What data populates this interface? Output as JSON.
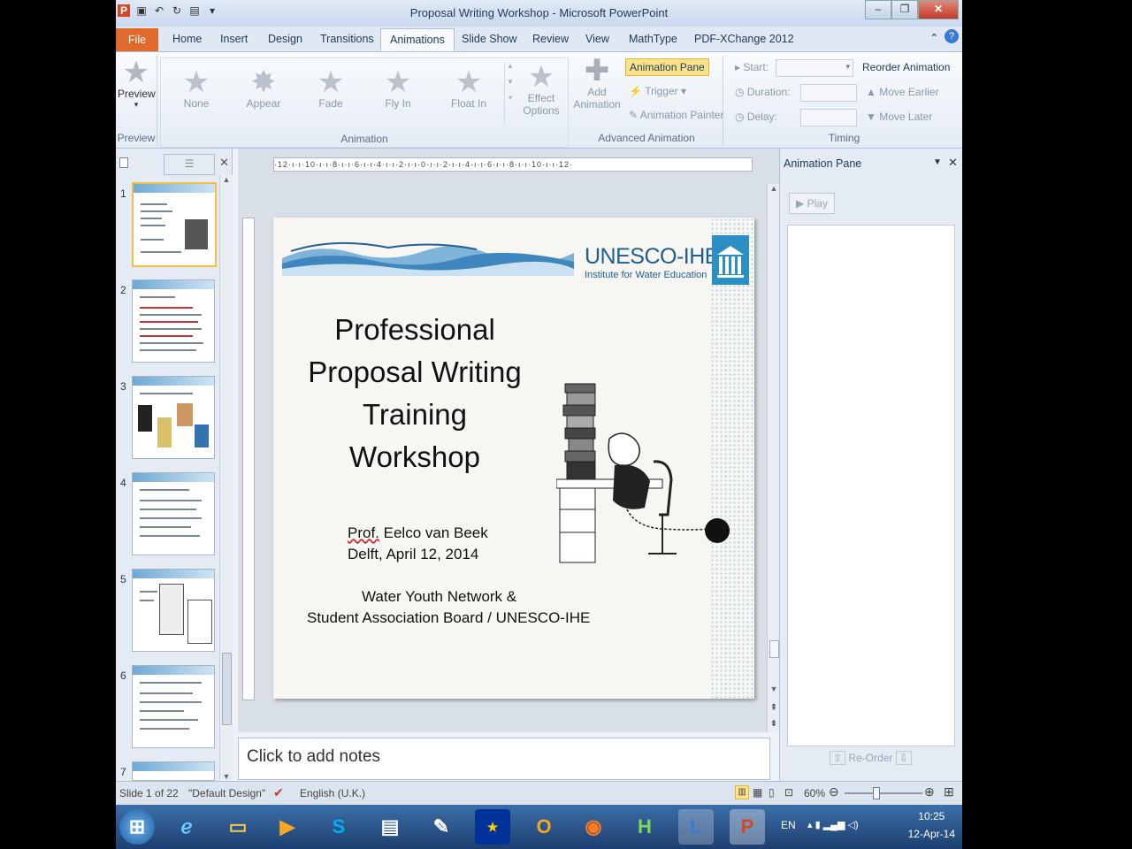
{
  "window": {
    "title": "Proposal Writing Workshop - Microsoft PowerPoint"
  },
  "tabs": [
    "File",
    "Home",
    "Insert",
    "Design",
    "Transitions",
    "Animations",
    "Slide Show",
    "Review",
    "View",
    "MathType",
    "PDF-XChange 2012"
  ],
  "active_tab": "Animations",
  "ribbon": {
    "preview": {
      "button": "Preview",
      "group": "Preview"
    },
    "animation": {
      "group": "Animation",
      "effects": [
        "None",
        "Appear",
        "Fade",
        "Fly In",
        "Float In"
      ],
      "effect_options": "Effect Options"
    },
    "advanced": {
      "group": "Advanced Animation",
      "add_animation": "Add Animation",
      "animation_pane": "Animation Pane",
      "trigger": "Trigger",
      "animation_painter": "Animation Painter"
    },
    "timing": {
      "group": "Timing",
      "start": "Start:",
      "duration": "Duration:",
      "delay": "Delay:",
      "reorder": "Reorder Animation",
      "move_earlier": "Move Earlier",
      "move_later": "Move Later"
    }
  },
  "slides_panel": {
    "numbers": [
      "1",
      "2",
      "3",
      "4",
      "5",
      "6",
      "7"
    ],
    "selected": 1
  },
  "ruler": {
    "text": "·12·ı·ı·10·ı·ı·8·ı·ı·6·ı·ı·4·ı·ı·2·ı·ı·0·ı·ı·2·ı·ı·4·ı·ı·6·ı·ı·8·ı·ı·10·ı·ı·12·"
  },
  "slide": {
    "logo": "UNESCO-IHE",
    "logo_sub": "Institute for Water Education",
    "title_lines": [
      "Professional",
      "Proposal Writing",
      "Training",
      "Workshop"
    ],
    "presenter_prefix": "Prof.",
    "presenter_name": " Eelco van Beek",
    "place_date": "Delft, April 12, 2014",
    "org_line1": "Water Youth  Network &",
    "org_line2": "Student  Association Board / UNESCO-IHE"
  },
  "notes": {
    "placeholder": "Click to add notes"
  },
  "animation_pane": {
    "title": "Animation Pane",
    "play": "Play",
    "reorder": "Re-Order"
  },
  "status": {
    "slide": "Slide 1 of 22",
    "theme": "\"Default Design\"",
    "language": "English (U.K.)",
    "zoom": "60%",
    "zoom_level": 0.4
  },
  "taskbar": {
    "lang": "EN",
    "time": "10:25",
    "date": "12-Apr-14"
  },
  "colors": {
    "file_tab": "#e06a2c",
    "accent": "#1b5e93",
    "highlight": "#fce38a"
  }
}
